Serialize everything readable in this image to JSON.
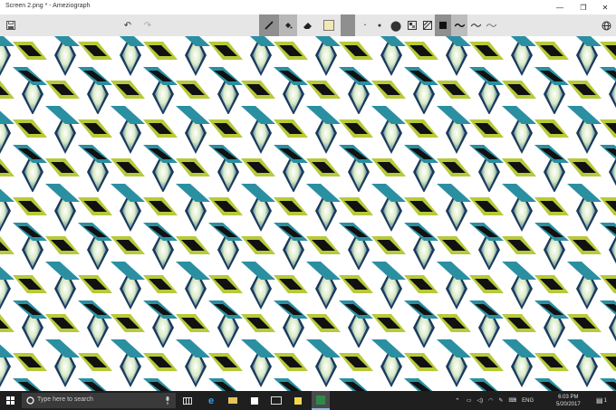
{
  "window": {
    "title": "Screen 2.png * - Ameziograph",
    "minimize_glyph": "—",
    "maximize_glyph": "❐",
    "close_glyph": "✕"
  },
  "toolbar": {
    "save_icon": "floppy-icon",
    "undo_glyph": "↶",
    "redo_glyph": "↷",
    "tools": [
      "brush-pen-icon",
      "fill-bucket-icon",
      "eraser-icon",
      "color-swatch-icon"
    ],
    "brush_sizes": [
      "•",
      "●",
      "⬤"
    ],
    "layers_icon": "layers-icon",
    "selected_color": "#f3e9b0"
  },
  "canvas": {
    "pattern": "kaleidoscope-hexagonal",
    "colors": {
      "dark_navy": "#1a3a5c",
      "teal": "#2b8fa2",
      "lime": "#b8c93a",
      "black": "#111111",
      "pale": "#eef4d8",
      "blue": "#3a78a8"
    }
  },
  "taskbar": {
    "search_placeholder": "Type here to search",
    "time": "6:03 PM",
    "date": "5/20/2017",
    "language": "ENG",
    "notification_count": "1"
  }
}
